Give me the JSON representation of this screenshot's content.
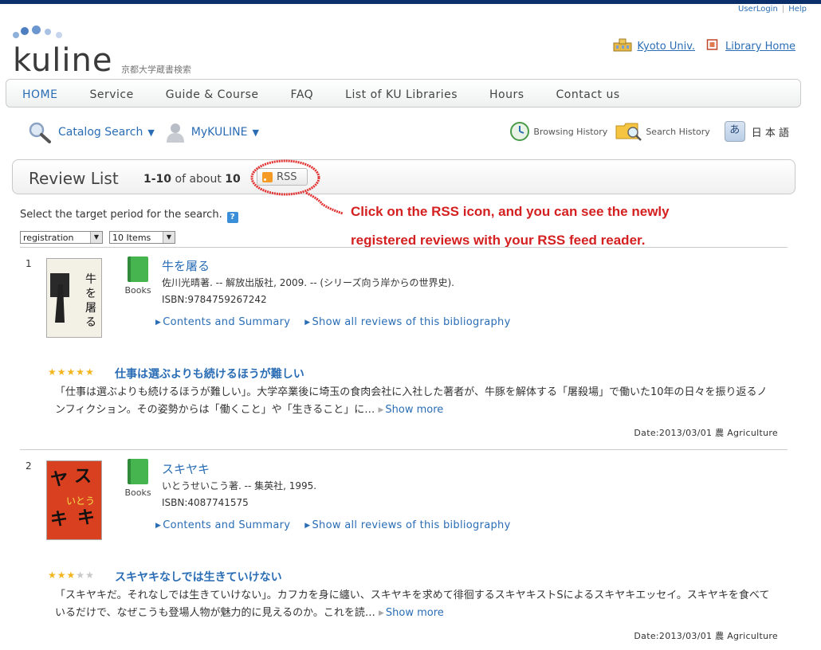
{
  "header": {
    "util_links": [
      "UserLogin",
      "Help"
    ],
    "logo_text": "kuline",
    "logo_sub": "京都大学蔵書検索",
    "inst_links": [
      "Kyoto Univ.",
      "Library Home"
    ]
  },
  "nav": {
    "items": [
      "HOME",
      "Service",
      "Guide & Course",
      "FAQ",
      "List of KU Libraries",
      "Hours",
      "Contact us"
    ],
    "active": "HOME"
  },
  "tools": {
    "catalog_search": "Catalog Search",
    "mykuline": "MyKULINE",
    "dropdown_glyph": "▼",
    "browsing_history": "Browsing History",
    "search_history": "Search History",
    "lang_glyph": "あ",
    "lang_label": "日 本 語"
  },
  "review_bar": {
    "title": "Review List",
    "range": "1-10",
    "of_about": "of about",
    "total": "10",
    "rss_label": "RSS"
  },
  "callout": {
    "line1": "Click on the RSS icon, and you can see the newly",
    "line2": "registered reviews with your RSS feed reader.",
    "color": "#d42020"
  },
  "filters": {
    "period_label": "Select the target period for the search.",
    "help_glyph": "?",
    "period_select": "registration",
    "items_select": "10 Items"
  },
  "records": [
    {
      "num": "1",
      "type": "Books",
      "title": "牛を屠る",
      "meta": "佐川光晴著. -- 解放出版社, 2009. -- (シリーズ向う岸からの世界史).",
      "isbn": "ISBN:9784759267242",
      "link_contents": "Contents and Summary",
      "link_reviews": "Show all reviews of this bibliography",
      "review_rating": 5,
      "review_title": "仕事は選ぶよりも続けるほうが難しい",
      "review_body": "「仕事は選ぶよりも続けるほうが難しい」。大学卒業後に埼玉の食肉会社に入社した著者が、牛豚を解体する「屠殺場」で働いた10年の日々を振り返るノンフィクション。その姿勢からは「働くこと」や「生きること」に…",
      "show_more": "Show more",
      "date": "Date:2013/03/01 農 Agriculture"
    },
    {
      "num": "2",
      "type": "Books",
      "title": "スキヤキ",
      "meta": "いとうせいこう著. -- 集英社, 1995.",
      "isbn": "ISBN:4087741575",
      "link_contents": "Contents and Summary",
      "link_reviews": "Show all reviews of this bibliography",
      "review_rating": 3,
      "review_title": "スキヤキなしでは生きていけない",
      "review_body": "「スキヤキだ。それなしでは生きていけない」。カフカを身に纏い、スキヤキを求めて徘徊するスキヤキストSによるスキヤキエッセイ。スキヤキを食べているだけで、なぜこうも登場人物が魅力的に見えるのか。これを読…",
      "show_more": "Show more",
      "date": "Date:2013/03/01 農 Agriculture"
    }
  ]
}
